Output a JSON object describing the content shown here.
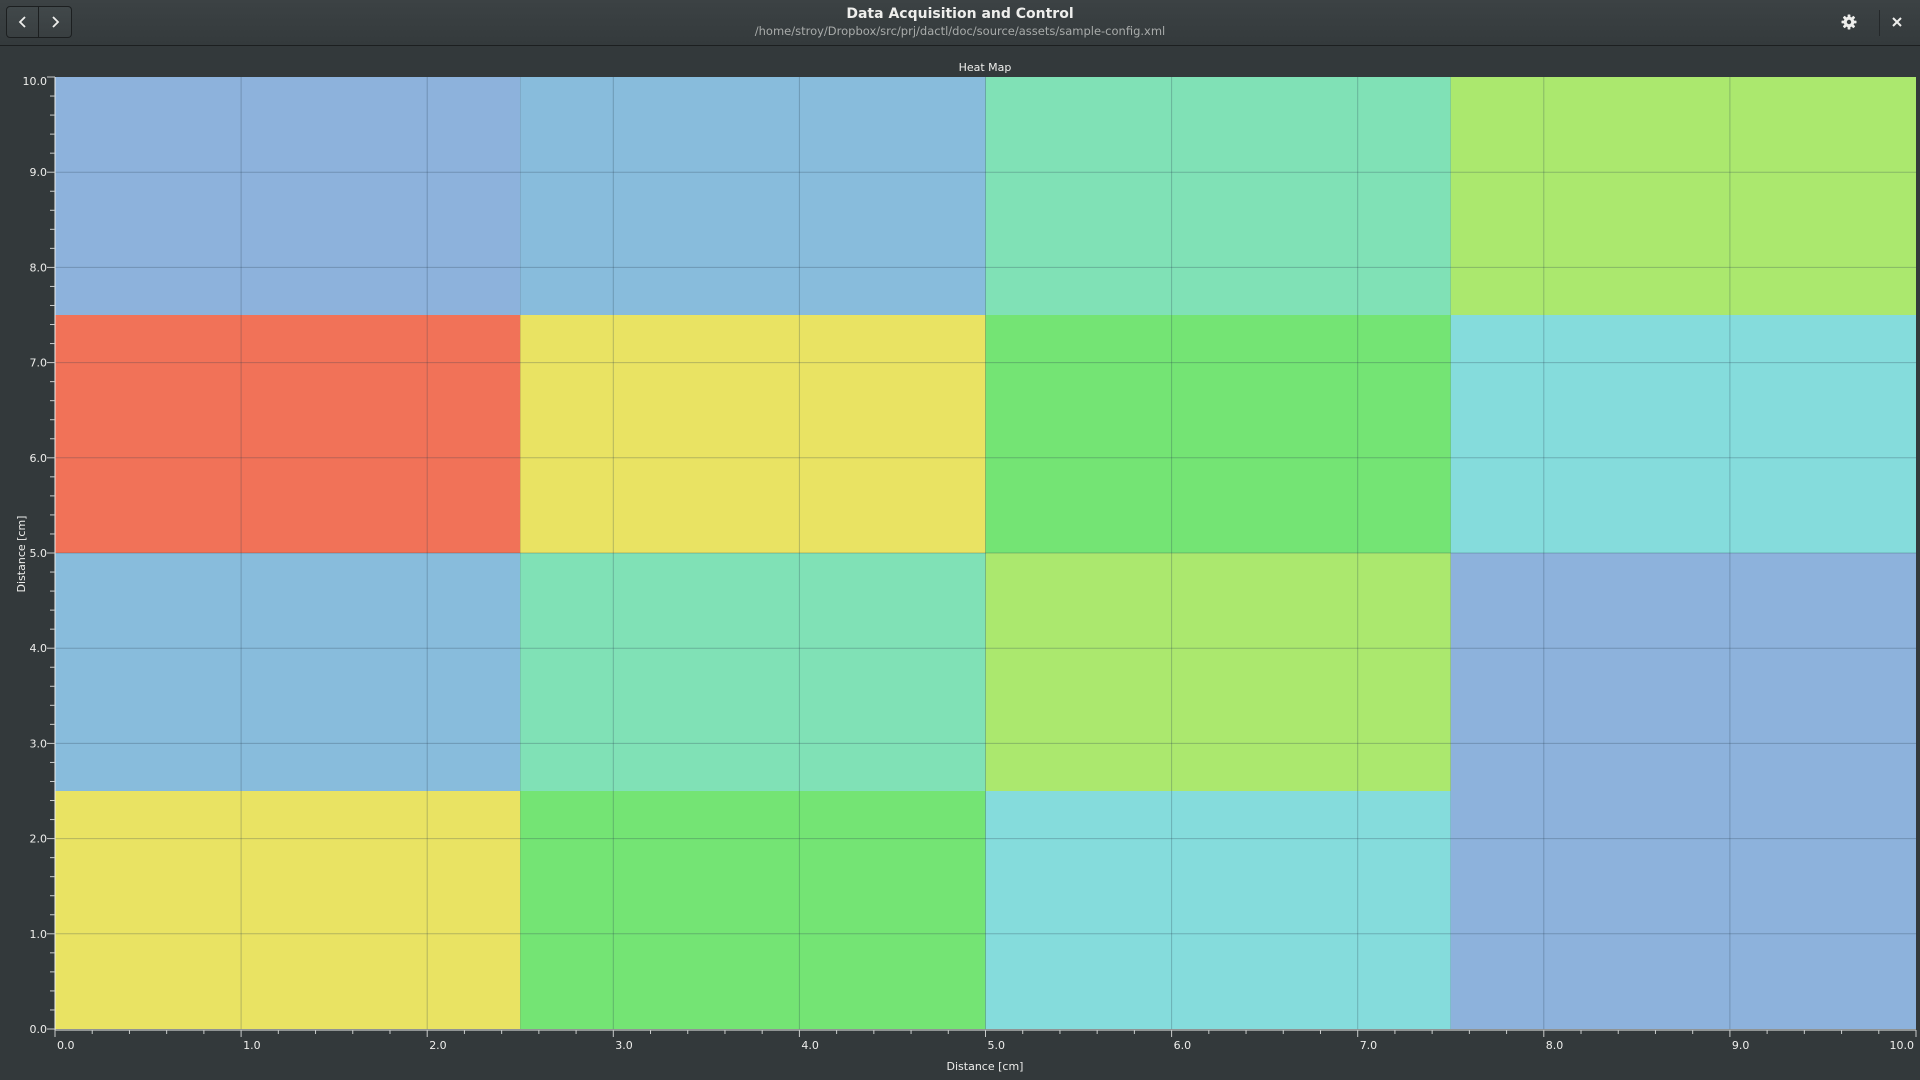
{
  "window": {
    "title": "Data Acquisition and Control",
    "subtitle": "/home/stroy/Dropbox/src/prj/dactl/doc/source/assets/sample-config.xml",
    "icons": {
      "back": "chevron-left-icon",
      "forward": "chevron-right-icon",
      "settings": "gear-icon",
      "close": "close-icon"
    }
  },
  "chart_data": {
    "type": "heatmap",
    "title": "Heat Map",
    "xlabel": "Distance [cm]",
    "ylabel": "Distance [cm]",
    "xlim": [
      0,
      10
    ],
    "ylim": [
      0,
      10
    ],
    "grid": true,
    "x_ticks": [
      "0.0",
      "1.0",
      "2.0",
      "3.0",
      "4.0",
      "5.0",
      "6.0",
      "7.0",
      "8.0",
      "9.0",
      "10.0"
    ],
    "y_ticks": [
      "0.0",
      "1.0",
      "2.0",
      "3.0",
      "4.0",
      "5.0",
      "6.0",
      "7.0",
      "8.0",
      "9.0",
      "10.0"
    ],
    "cells": [
      {
        "x0": 0,
        "x1": 2.5,
        "y0": 0,
        "y1": 2.5,
        "color": "#e9e363"
      },
      {
        "x0": 2.5,
        "x1": 5,
        "y0": 0,
        "y1": 2.5,
        "color": "#74e474"
      },
      {
        "x0": 5,
        "x1": 7.5,
        "y0": 0,
        "y1": 2.5,
        "color": "#85dcdc"
      },
      {
        "x0": 7.5,
        "x1": 10,
        "y0": 0,
        "y1": 2.5,
        "color": "#8db2dc"
      },
      {
        "x0": 0,
        "x1": 2.5,
        "y0": 2.5,
        "y1": 5,
        "color": "#88bcdc"
      },
      {
        "x0": 2.5,
        "x1": 5,
        "y0": 2.5,
        "y1": 5,
        "color": "#80e1b6"
      },
      {
        "x0": 5,
        "x1": 7.5,
        "y0": 2.5,
        "y1": 5,
        "color": "#abe86e"
      },
      {
        "x0": 7.5,
        "x1": 10,
        "y0": 2.5,
        "y1": 5,
        "color": "#8db2dc"
      },
      {
        "x0": 0,
        "x1": 2.5,
        "y0": 5,
        "y1": 7.5,
        "color": "#f17258"
      },
      {
        "x0": 2.5,
        "x1": 5,
        "y0": 5,
        "y1": 7.5,
        "color": "#e9e363"
      },
      {
        "x0": 5,
        "x1": 7.5,
        "y0": 5,
        "y1": 7.5,
        "color": "#74e474"
      },
      {
        "x0": 7.5,
        "x1": 10,
        "y0": 5,
        "y1": 7.5,
        "color": "#85dcdc"
      },
      {
        "x0": 0,
        "x1": 2.5,
        "y0": 7.5,
        "y1": 10,
        "color": "#8db2dc"
      },
      {
        "x0": 2.5,
        "x1": 5,
        "y0": 7.5,
        "y1": 10,
        "color": "#88bcdc"
      },
      {
        "x0": 5,
        "x1": 7.5,
        "y0": 7.5,
        "y1": 10,
        "color": "#80e1b6"
      },
      {
        "x0": 7.5,
        "x1": 10,
        "y0": 7.5,
        "y1": 10,
        "color": "#abe86e"
      }
    ]
  }
}
